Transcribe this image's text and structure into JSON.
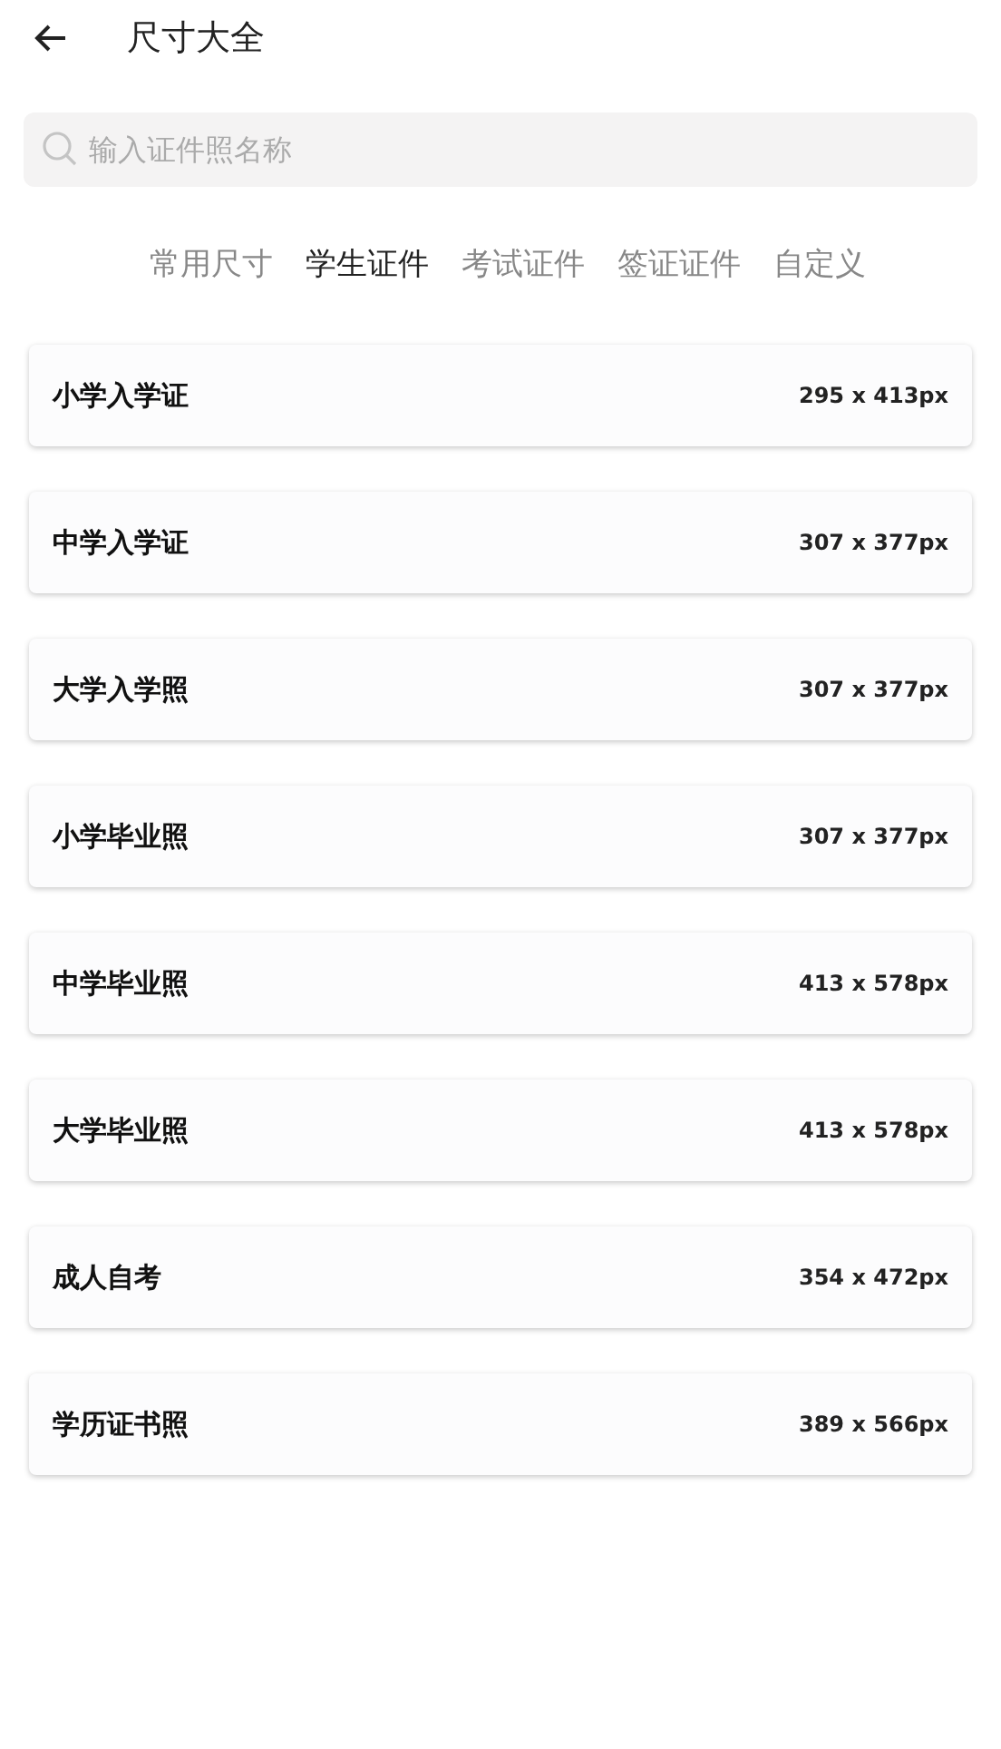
{
  "header": {
    "title": "尺寸大全"
  },
  "search": {
    "placeholder": "输入证件照名称"
  },
  "tabs": [
    {
      "label": "常用尺寸",
      "selected": false
    },
    {
      "label": "学生证件",
      "selected": true
    },
    {
      "label": "考试证件",
      "selected": false
    },
    {
      "label": "签证证件",
      "selected": false
    },
    {
      "label": "自定义",
      "selected": false
    }
  ],
  "items": [
    {
      "name": "小学入学证",
      "size": "295 x 413px"
    },
    {
      "name": "中学入学证",
      "size": "307 x 377px"
    },
    {
      "name": "大学入学照",
      "size": "307 x 377px"
    },
    {
      "name": "小学毕业照",
      "size": "307 x 377px"
    },
    {
      "name": "中学毕业照",
      "size": "413 x 578px"
    },
    {
      "name": "大学毕业照",
      "size": "413 x 578px"
    },
    {
      "name": "成人自考",
      "size": "354 x 472px"
    },
    {
      "name": "学历证书照",
      "size": "389 x 566px"
    }
  ]
}
